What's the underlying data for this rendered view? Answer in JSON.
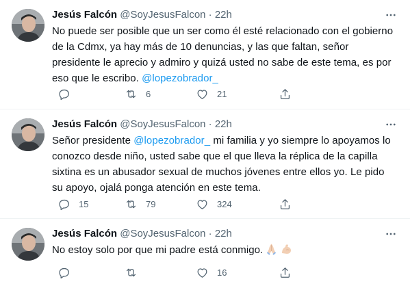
{
  "tweets": [
    {
      "author_name": "Jesús Falcón",
      "handle": "@SoyJesusFalcon",
      "separator": "·",
      "time": "22h",
      "text_before": "No puede ser posible que un ser como él esté relacionado con el gobierno de la Cdmx, ya hay más de 10 denuncias, y las que faltan, señor presidente le aprecio y admiro y quizá usted no sabe de este tema, es por eso que le escribo. ",
      "mention": "@lopezobrador_",
      "text_after": "",
      "reply_count": "",
      "retweet_count": "6",
      "like_count": "21"
    },
    {
      "author_name": "Jesús Falcón",
      "handle": "@SoyJesusFalcon",
      "separator": "·",
      "time": "22h",
      "text_before": "Señor presidente ",
      "mention": "@lopezobrador_",
      "text_after": " mi familia y yo siempre lo apoyamos lo conozco desde niño, usted sabe que el que lleva la réplica de la capilla sixtina es un abusador sexual de muchos jóvenes entre ellos yo. Le pido su apoyo, ojalá ponga atención en este tema.",
      "reply_count": "15",
      "retweet_count": "79",
      "like_count": "324"
    },
    {
      "author_name": "Jesús Falcón",
      "handle": "@SoyJesusFalcon",
      "separator": "·",
      "time": "22h",
      "text_before": "No estoy solo por que mi padre está conmigo.",
      "mention": "",
      "text_after": "",
      "emojis": [
        "folded-hands-emoji",
        "flexed-biceps-emoji"
      ],
      "reply_count": "",
      "retweet_count": "",
      "like_count": "16"
    }
  ],
  "icons": {
    "more": "more-icon",
    "reply": "reply-icon",
    "retweet": "retweet-icon",
    "like": "like-icon",
    "share": "share-icon"
  },
  "colors": {
    "text": "#0f1419",
    "secondary": "#536471",
    "mention": "#1d9bf0",
    "divider": "#eff3f4"
  }
}
